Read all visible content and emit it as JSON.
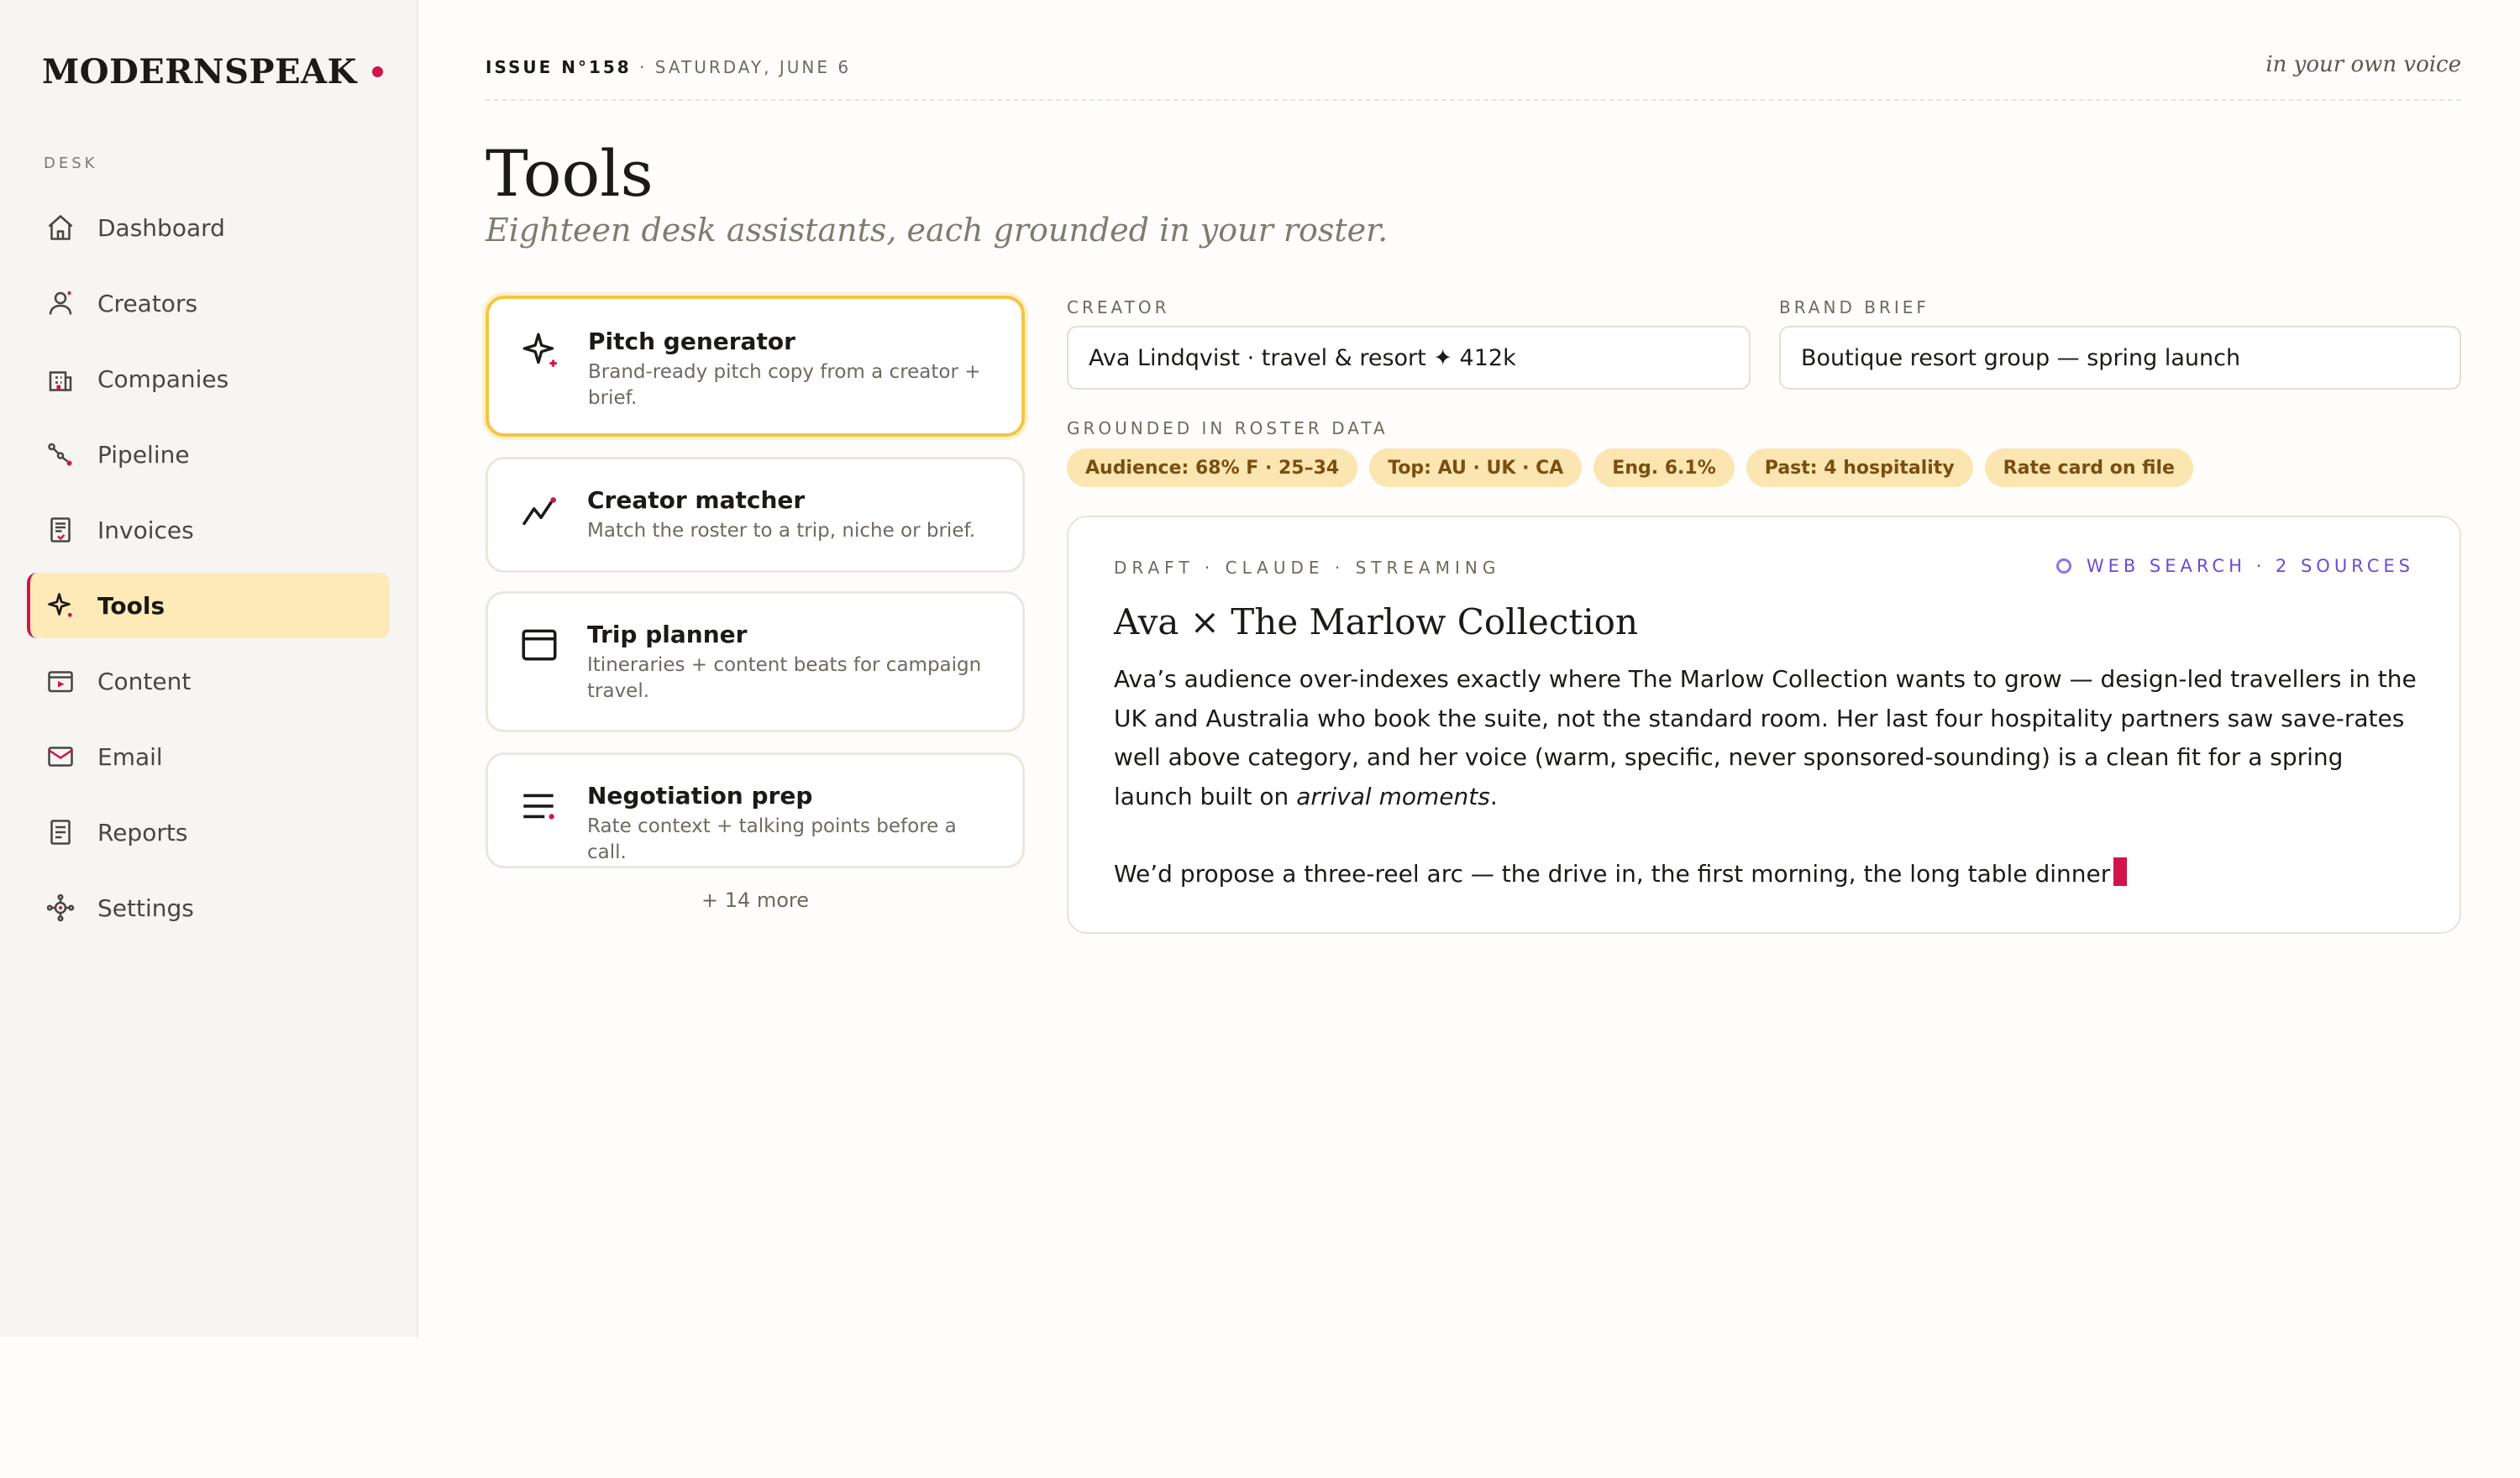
{
  "app": {
    "name": "MODERNSPEAK"
  },
  "sidebar": {
    "section": "DESK",
    "items": [
      {
        "label": "Dashboard",
        "icon": "home-icon"
      },
      {
        "label": "Creators",
        "icon": "person-icon"
      },
      {
        "label": "Companies",
        "icon": "building-icon"
      },
      {
        "label": "Pipeline",
        "icon": "pipeline-icon"
      },
      {
        "label": "Invoices",
        "icon": "receipt-icon"
      },
      {
        "label": "Tools",
        "icon": "sparkle-icon",
        "active": true
      },
      {
        "label": "Content",
        "icon": "content-icon"
      },
      {
        "label": "Email",
        "icon": "mail-icon"
      },
      {
        "label": "Reports",
        "icon": "report-icon"
      },
      {
        "label": "Settings",
        "icon": "settings-icon"
      }
    ]
  },
  "header": {
    "issue": "ISSUE N°158",
    "date": " · SATURDAY, JUNE 6",
    "tagline": "in your own voice"
  },
  "page": {
    "title": "Tools",
    "subtitle": "Eighteen desk assistants, each grounded in your roster."
  },
  "tools": [
    {
      "name": "Pitch generator",
      "desc": "Brand-ready pitch copy from a creator + brief.",
      "icon": "sparkle-icon",
      "selected": true
    },
    {
      "name": "Creator matcher",
      "desc": "Match the roster to a trip, niche or brief.",
      "icon": "trend-icon"
    },
    {
      "name": "Trip planner",
      "desc": "Itineraries + content beats for campaign travel.",
      "icon": "window-icon"
    },
    {
      "name": "Negotiation prep",
      "desc": "Rate context + talking points before a call.",
      "icon": "lines-icon"
    }
  ],
  "more_tools": "+ 14 more",
  "form": {
    "creator_label": "CREATOR",
    "creator_value": "Ava Lindqvist · travel & resort ✦ 412k",
    "brief_label": "BRAND BRIEF",
    "brief_value": "Boutique resort group — spring launch"
  },
  "grounding": {
    "label": "GROUNDED IN ROSTER DATA",
    "chips": [
      "Audience: 68% F · 25–34",
      "Top: AU · UK · CA",
      "Eng. 6.1%",
      "Past: 4 hospitality",
      "Rate card on file"
    ]
  },
  "draft": {
    "meta": "DRAFT · CLAUDE · STREAMING",
    "sources": "WEB SEARCH · 2 SOURCES",
    "title": "Ava × The Marlow Collection",
    "para1_main": "Ava’s audience over-indexes exactly where The Marlow Collection wants to grow — design-led travellers in the UK and Australia who book the suite, not the standard room. Her last four hospitality partners saw save-rates well above category, and her voice (warm, specific, never sponsored-sounding) is a clean fit for a spring launch built on ",
    "para1_em": "arrival moments",
    "para1_end": ".",
    "para2": "We’d propose a three-reel arc — the drive in, the first morning, the long table dinner"
  },
  "colors": {
    "accent": "#d1154a",
    "highlight": "#fdeab8",
    "selected_border": "#f4c445",
    "chip_bg": "#fbe5b0",
    "search": "#6a4bd6"
  }
}
